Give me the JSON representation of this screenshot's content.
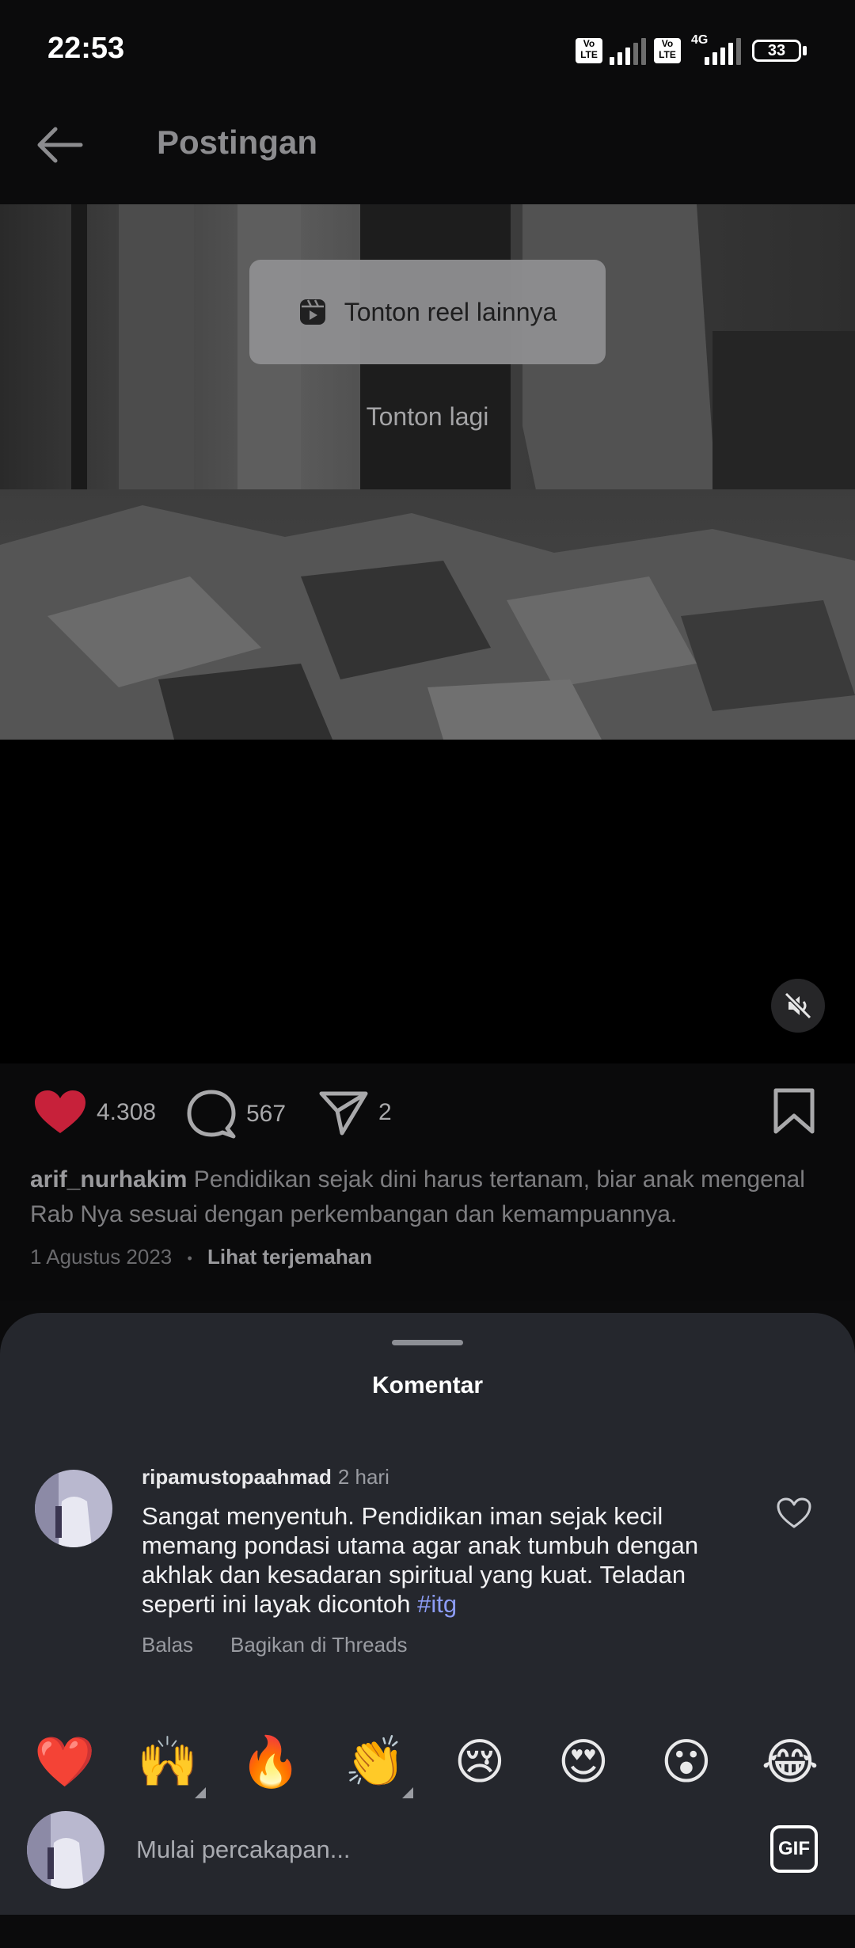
{
  "status_bar": {
    "time": "22:53",
    "volte_1": "Vo LTE",
    "volte_2": "Vo LTE",
    "network": "4G",
    "battery": "33"
  },
  "header": {
    "title": "Postingan",
    "back_icon": "arrow-left-icon"
  },
  "video": {
    "watch_more_label": "Tonton reel lainnya",
    "watch_more_icon": "reels-icon",
    "replay_label": "Tonton lagi",
    "mute_icon": "speaker-muted-icon"
  },
  "actions": {
    "likes": "4.308",
    "comments": "567",
    "shares": "2",
    "like_color": "#c7213a"
  },
  "caption": {
    "username": "arif_nurhakim",
    "text": "Pendidikan sejak dini harus tertanam, biar anak mengenal Rab Nya sesuai dengan perkembangan dan kemampuannya.",
    "date": "1 Agustus 2023",
    "separator": "•",
    "translate": "Lihat terjemahan"
  },
  "comments_sheet": {
    "title": "Komentar",
    "items": [
      {
        "username": "ripamustopaahmad",
        "time": "2 hari",
        "text": "Sangat menyentuh. Pendidikan iman sejak kecil memang pondasi utama agar anak tumbuh dengan akhlak dan kesadaran spiritual yang kuat. Teladan seperti ini layak dicontoh",
        "hashtag": "#itg",
        "reply": "Balas",
        "share": "Bagikan di Threads"
      }
    ]
  },
  "emoji_bar": [
    "❤️",
    "🙌",
    "🔥",
    "👏",
    "😢",
    "😍",
    "😮",
    "😂"
  ],
  "input": {
    "placeholder": "Mulai percakapan...",
    "gif_label": "GIF"
  },
  "colors": {
    "sheet_bg": "#25272d",
    "hashtag": "#8c9cf5",
    "background": "#0b0b0c"
  }
}
